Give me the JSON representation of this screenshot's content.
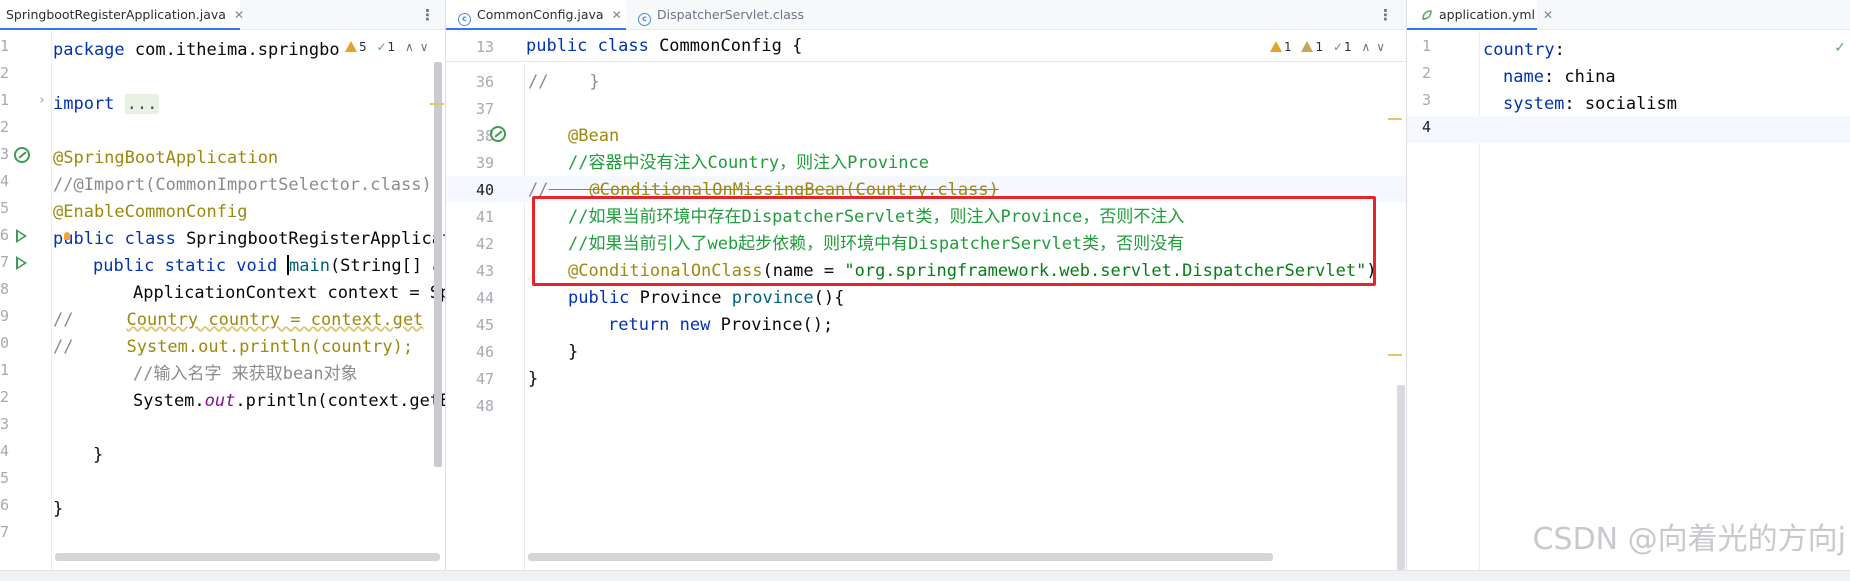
{
  "left": {
    "tab": "SpringbootRegisterApplication.java",
    "inspections": {
      "warnings": "5",
      "checks": "1"
    },
    "line_numbers": [
      "1",
      "2",
      "3",
      "4",
      "5",
      "6",
      "7",
      "8",
      "9",
      "0",
      "1",
      "2",
      "3",
      "4",
      "5",
      "6",
      "7"
    ],
    "code": {
      "l1_kw": "package",
      "l1_rest": " com.itheima.springbo",
      "l3_kw": "import ",
      "l3_fold": "...",
      "l5": "@SpringBootApplication",
      "l6": "//@Import(CommonImportSelector.class)",
      "l7": "@EnableCommonConfig",
      "l8_kw": "public class",
      "l8_rest": " SpringbootRegisterApplicat",
      "l9_kw": "public static void",
      "l9_mth": "main",
      "l9_rest": "(String[] ar",
      "l10": "ApplicationContext context = Sp",
      "l11_c": "//",
      "l11_rest": "Country country = context.get",
      "l12_c": "//",
      "l12_rest": "System.out.println(country);",
      "l13": "//输入名字 来获取bean对象",
      "l14_a": "System.",
      "l14_fld": "out",
      "l14_b": ".println(context.getB",
      "l16": "}",
      "l18": "}"
    }
  },
  "middle": {
    "tabs": [
      {
        "label": "CommonConfig.java",
        "active": true
      },
      {
        "label": "DispatcherServlet.class",
        "active": false
      }
    ],
    "inspections": {
      "warnings_a": "1",
      "warnings_b": "1",
      "checks": "1"
    },
    "sticky": {
      "num": "13",
      "kw": "public class",
      "rest": " CommonConfig {"
    },
    "line_numbers": [
      "36",
      "37",
      "38",
      "39",
      "40",
      "41",
      "42",
      "43",
      "44",
      "45",
      "46",
      "47",
      "48"
    ],
    "current_line": "40",
    "code": {
      "l36": "//    }",
      "l38": "@Bean",
      "l39": "//容器中没有注入Country，则注入Province",
      "l40_c": "//",
      "l40_rest": "    @ConditionalOnMissingBean(Country.class)",
      "l41": "//如果当前环境中存在DispatcherServlet类，则注入Province，否则不注入",
      "l42": "//如果当前引入了web起步依赖，则环境中有DispatcherServlet类，否则没有",
      "l43_ann": "@ConditionalOnClass",
      "l43_mid": "(name = ",
      "l43_str": "\"org.springframework.web.servlet.DispatcherServlet\"",
      "l43_end": ")",
      "l44_kw": "public",
      "l44_mid": " Province ",
      "l44_mth": "province",
      "l44_end": "(){",
      "l45_kw": "return new",
      "l45_rest": " Province();",
      "l46": "}",
      "l47": "}"
    }
  },
  "right": {
    "tab": "application.yml",
    "line_numbers": [
      "1",
      "2",
      "3",
      "4"
    ],
    "yaml": {
      "k1": "country",
      "colon1": ":",
      "k2": "name",
      "v2": ": china",
      "k3": "system",
      "v3": ": socialism"
    }
  },
  "watermark": "CSDN @向着光的方向j",
  "colors": {
    "keyword": "#0033b3",
    "annotation": "#9e880d",
    "comment_gray": "#8c8c8c",
    "comment_green": "#1f9d3a",
    "string": "#067d17",
    "method": "#00627a",
    "highlight_box": "#e4262a",
    "active_tab_underline": "#3574f0"
  },
  "icons": [
    "run-gutter-icon",
    "bean-gutter-icon",
    "warning-icon",
    "check-icon",
    "close-icon",
    "more-icon",
    "class-file-icon",
    "spring-yaml-icon"
  ]
}
